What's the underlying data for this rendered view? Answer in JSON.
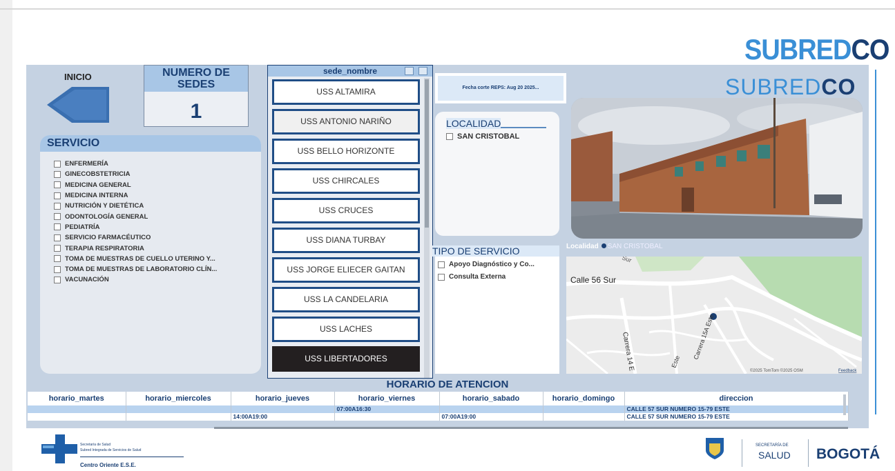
{
  "brand": {
    "top_logo_a": "SUBRED",
    "top_logo_b": "CO",
    "panel_logo_a": "SUBRED",
    "panel_logo_b": "CO"
  },
  "nav": {
    "inicio": "INICIO"
  },
  "kpi": {
    "title": "NUMERO DE SEDES",
    "value": "1"
  },
  "servicio": {
    "title": "SERVICIO",
    "items": [
      "ENFERMERÍA",
      "GINECOBSTETRICIA",
      "MEDICINA GENERAL",
      "MEDICINA INTERNA",
      "NUTRICIÓN Y DIETÉTICA",
      "ODONTOLOGÍA GENERAL",
      "PEDIATRÍA",
      "SERVICIO FARMACÉUTICO",
      "TERAPIA RESPIRATORIA",
      "TOMA DE MUESTRAS DE CUELLO UTERINO Y...",
      "TOMA DE MUESTRAS DE LABORATORIO CLÍN...",
      "VACUNACIÓN"
    ]
  },
  "sede": {
    "header": "sede_nombre",
    "items": [
      "USS ALTAMIRA",
      "USS ANTONIO NARIÑO",
      "USS BELLO HORIZONTE",
      "USS CHIRCALES",
      "USS CRUCES",
      "USS DIANA TURBAY",
      "USS JORGE ELIECER GAITAN",
      "USS LA CANDELARIA",
      "USS LACHES",
      "USS LIBERTADORES"
    ],
    "selected": "USS LIBERTADORES"
  },
  "fecha": "Fecha corte REPS: Aug 20 2025...",
  "localidad": {
    "title": "LOCALIDAD",
    "items": [
      "SAN CRISTOBAL"
    ]
  },
  "tipo_servicio": {
    "title": "TIPO DE SERVICIO",
    "items": [
      "Apoyo Diagnóstico y Co...",
      "Consulta Externa"
    ]
  },
  "map": {
    "legend_label": "Localidad",
    "legend_value": "SAN CRISTOBAL",
    "street_1": "Calle 56 Sur",
    "street_2": "Carrera 14 E",
    "street_3": "Carrera 15A Este",
    "street_4": "Este",
    "street_5": "Sur",
    "attribution": "©2025 TomTom  ©2025 OSM",
    "feedback": "Feedback"
  },
  "horario": {
    "title": "HORARIO DE ATENCION",
    "columns": [
      "horario_martes",
      "horario_miercoles",
      "horario_jueves",
      "horario_viernes",
      "horario_sabado",
      "horario_domingo",
      "direccion"
    ],
    "rows": [
      [
        "",
        "",
        "",
        "07:00A16:30",
        "",
        "",
        "CALLE 57 SUR NUMERO 15-79 ESTE"
      ],
      [
        "",
        "",
        "14:00A19:00",
        "",
        "07:00A19:00",
        "",
        "CALLE 57 SUR NUMERO 15-79 ESTE"
      ]
    ]
  },
  "footer": {
    "sec_line1": "Secretaría de Salud",
    "sec_line2": "Subred Integrada de Servicios de Salud",
    "sec_line3": "Centro Oriente E.S.E.",
    "secretaria_de": "SECRETARÍA DE",
    "salud": "SALUD",
    "bogota": "BOGOTÁ"
  },
  "colors": {
    "navy": "#1a3f73",
    "accent": "#3a8fd6",
    "panel_bg": "#c5d2e2",
    "header_blue": "#a8c6e6",
    "selected_dark": "#231f20"
  }
}
